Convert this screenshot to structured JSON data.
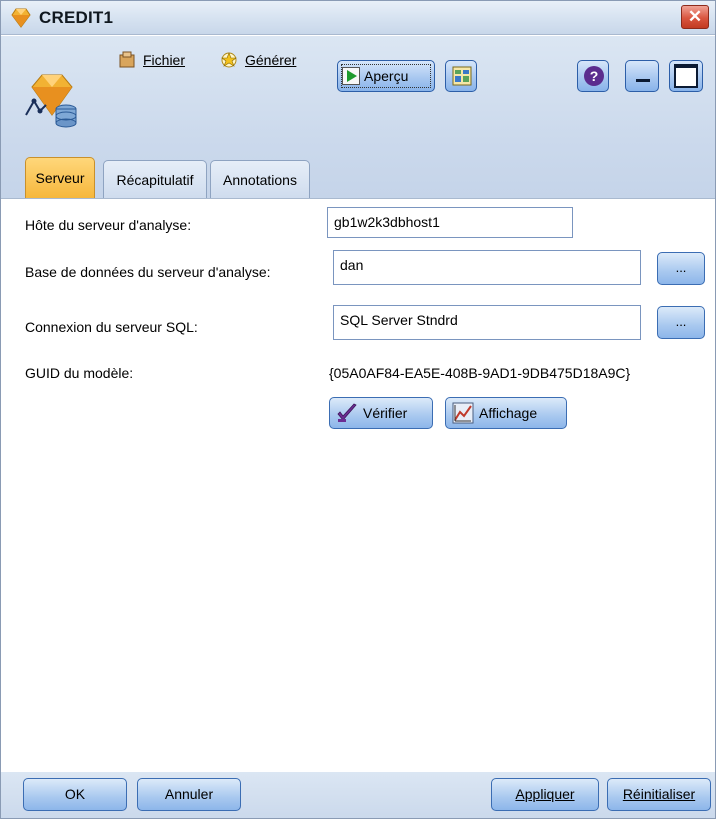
{
  "window": {
    "title": "CREDIT1",
    "close_glyph": "✕"
  },
  "toolbar": {
    "fichier_label": "Fichier",
    "generer_label": "Générer",
    "apercu_label": "Aperçu",
    "help_glyph": "?",
    "icons": {
      "fichier": "file-menu-icon",
      "generer": "generate-icon",
      "apercu": "preview-play-icon",
      "export": "export-table-icon",
      "help": "help-icon",
      "minimize": "minimize-icon",
      "maximize": "maximize-icon"
    }
  },
  "tabs": [
    {
      "label": "Serveur",
      "active": true
    },
    {
      "label": "Récapitulatif",
      "active": false
    },
    {
      "label": "Annotations",
      "active": false
    }
  ],
  "form": {
    "host_label": "Hôte du serveur d'analyse:",
    "host_value": "gb1w2k3dbhost1",
    "db_label": "Base de données du serveur d'analyse:",
    "db_value": "dan",
    "sql_label": "Connexion du serveur SQL:",
    "sql_value": "SQL Server Stndrd",
    "browse_label": "...",
    "guid_label": "GUID du modèle:",
    "guid_value": "{05A0AF84-EA5E-408B-9AD1-9DB475D18A9C}",
    "verify_label": "Vérifier",
    "display_label": "Affichage"
  },
  "footer": {
    "ok_label": "OK",
    "cancel_label": "Annuler",
    "apply_label": "Appliquer",
    "reset_label": "Réinitialiser"
  },
  "colors": {
    "title_gradient_top": "#e9f0f8",
    "header_band": "#cbd9ec",
    "active_tab": "#f6b73c",
    "button_blue": "#a8c8ef",
    "close_red": "#d9553f"
  }
}
